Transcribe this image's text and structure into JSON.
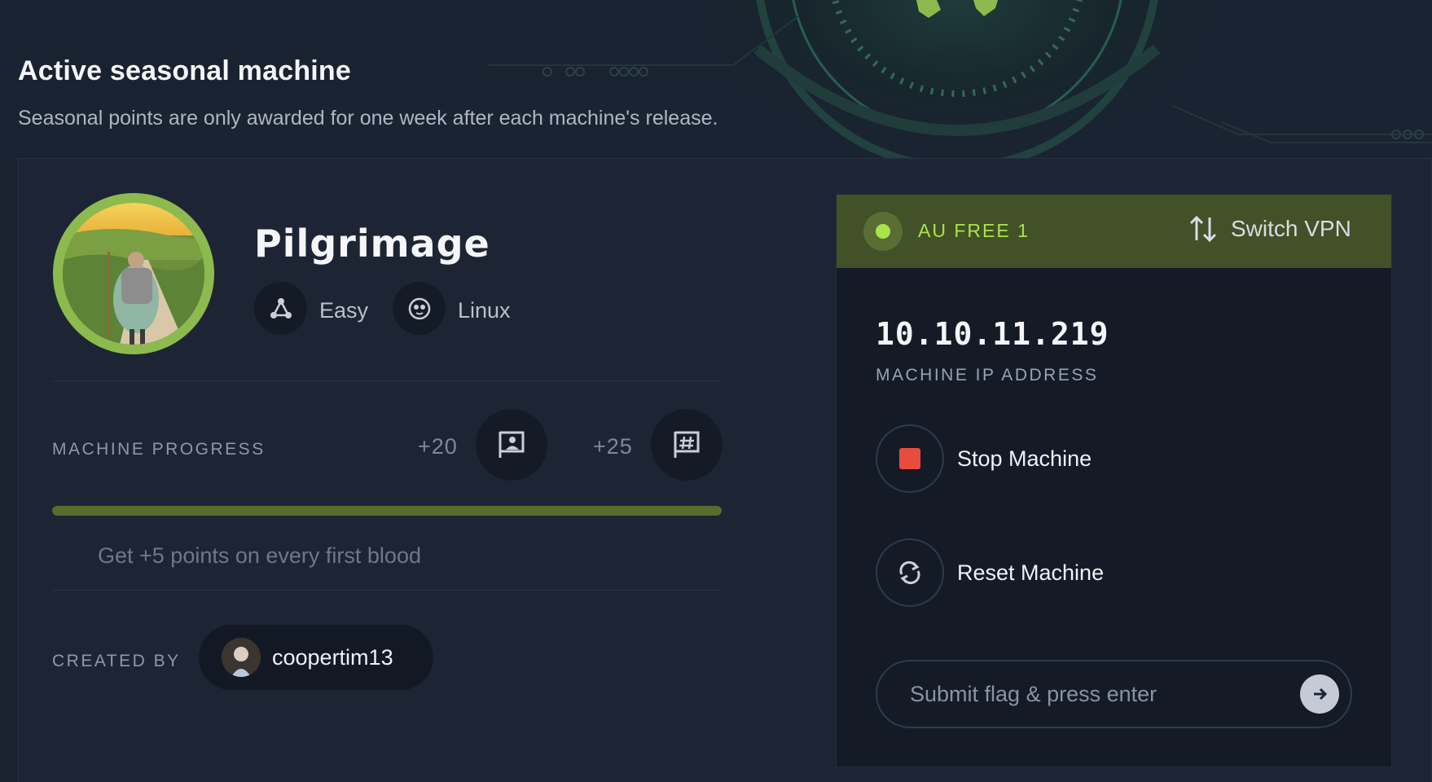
{
  "section": {
    "title": "Active seasonal machine",
    "subtitle": "Seasonal points are only awarded for one week after each machine's release."
  },
  "machine": {
    "name": "Pilgrimage",
    "difficulty": "Easy",
    "os": "Linux",
    "avatar_icon": "pilgrim-avatar"
  },
  "progress": {
    "label": "MACHINE PROGRESS",
    "user_points": "+20",
    "root_points": "+25",
    "user_flag_icon": "user-flag-icon",
    "root_flag_icon": "root-flag-icon",
    "fraction": 0.0,
    "first_blood_hint": "Get +5 points on every first blood"
  },
  "creator": {
    "label": "CREATED BY",
    "name": "coopertim13"
  },
  "vpn": {
    "server": "AU FREE 1",
    "switch_label": "Switch VPN",
    "status_color": "#a8e44a"
  },
  "target": {
    "ip": "10.10.11.219",
    "ip_label": "MACHINE IP ADDRESS"
  },
  "actions": {
    "stop_label": "Stop Machine",
    "reset_label": "Reset Machine",
    "stop_color": "#e74c3c"
  },
  "flag_submit": {
    "placeholder": "Submit flag & press enter"
  },
  "colors": {
    "accent_green": "#8dba4e",
    "background": "#1a2230",
    "card": "#1d2535",
    "panel": "#141b27"
  }
}
